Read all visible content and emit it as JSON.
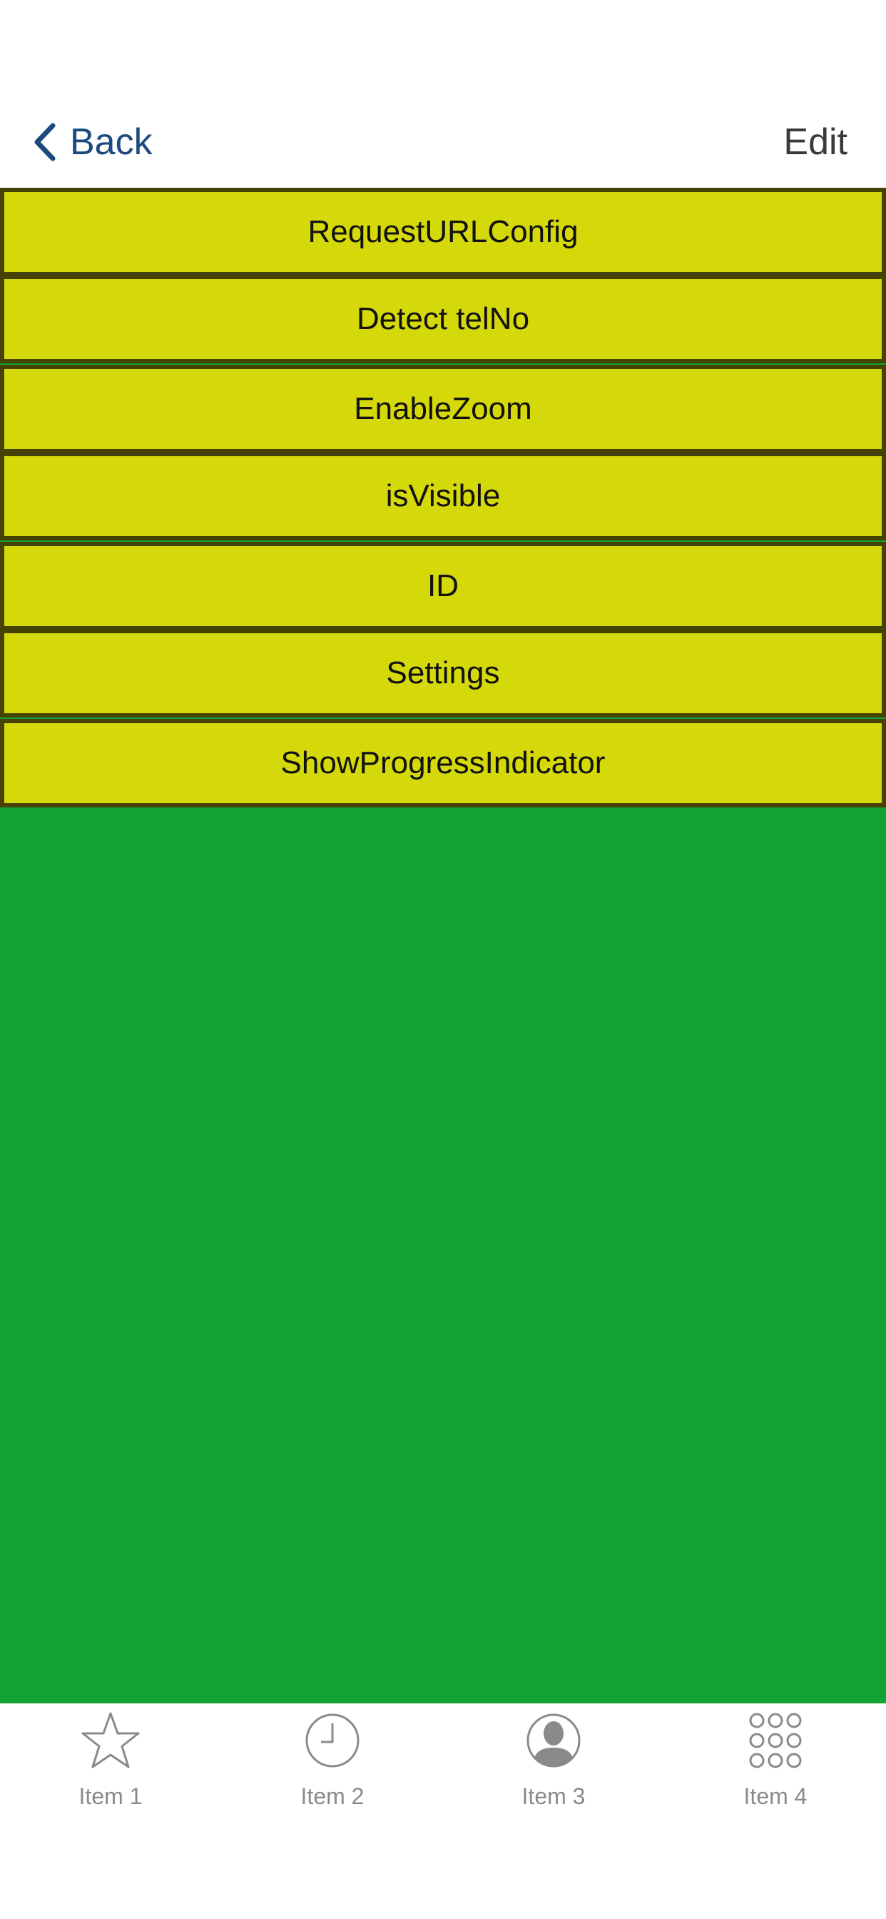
{
  "nav": {
    "back_label": "Back",
    "edit_label": "Edit"
  },
  "list": {
    "items": [
      {
        "label": "RequestURLConfig"
      },
      {
        "label": "Detect telNo"
      },
      {
        "label": "EnableZoom"
      },
      {
        "label": "isVisible"
      },
      {
        "label": "ID"
      },
      {
        "label": "Settings"
      },
      {
        "label": "ShowProgressIndicator"
      }
    ]
  },
  "tabs": [
    {
      "label": "Item 1",
      "icon": "star-icon"
    },
    {
      "label": "Item 2",
      "icon": "clock-icon"
    },
    {
      "label": "Item 3",
      "icon": "person-icon"
    },
    {
      "label": "Item 4",
      "icon": "grid-icon"
    }
  ],
  "colors": {
    "background": "#12a334",
    "row_fill": "#d5d90a",
    "row_border": "#464205",
    "nav_tint": "#1a4a7e",
    "tab_inactive": "#8a8a8a"
  }
}
